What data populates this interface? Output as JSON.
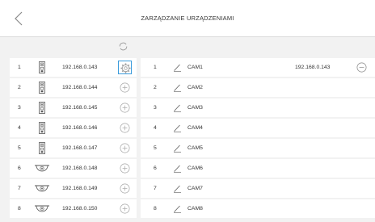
{
  "header": {
    "title": "ZARZĄDZANIE URZĄDZENIAMI"
  },
  "icons": {
    "back": "chevron-left-icon",
    "refresh": "refresh-icon",
    "settings": "gear-icon",
    "add": "plus-circle-icon",
    "edit": "pencil-icon",
    "remove": "minus-circle-icon"
  },
  "colors": {
    "background": "#f2f2f2",
    "row": "#ffffff",
    "selected_outline": "#3a9bdc",
    "icon": "#9a9a9a"
  },
  "devices": [
    {
      "num": "1",
      "type": "door-station-icon",
      "ip": "192.168.0.143",
      "action": "settings",
      "selected": true
    },
    {
      "num": "2",
      "type": "door-station-icon",
      "ip": "192.168.0.144",
      "action": "add",
      "selected": false
    },
    {
      "num": "3",
      "type": "door-station-icon",
      "ip": "192.168.0.145",
      "action": "add",
      "selected": false
    },
    {
      "num": "4",
      "type": "door-station-icon",
      "ip": "192.168.0.146",
      "action": "add",
      "selected": false
    },
    {
      "num": "5",
      "type": "door-station-icon",
      "ip": "192.168.0.147",
      "action": "add",
      "selected": false
    },
    {
      "num": "6",
      "type": "dome-camera-icon",
      "ip": "192.168.0.148",
      "action": "add",
      "selected": false
    },
    {
      "num": "7",
      "type": "dome-camera-icon",
      "ip": "192.168.0.149",
      "action": "add",
      "selected": false
    },
    {
      "num": "8",
      "type": "dome-camera-icon",
      "ip": "192.168.0.150",
      "action": "add",
      "selected": false
    }
  ],
  "cameras": [
    {
      "num": "1",
      "name": "CAM1",
      "ip": "192.168.0.143",
      "assigned": true
    },
    {
      "num": "2",
      "name": "CAM2",
      "ip": "",
      "assigned": false
    },
    {
      "num": "3",
      "name": "CAM3",
      "ip": "",
      "assigned": false
    },
    {
      "num": "4",
      "name": "CAM4",
      "ip": "",
      "assigned": false
    },
    {
      "num": "5",
      "name": "CAM5",
      "ip": "",
      "assigned": false
    },
    {
      "num": "6",
      "name": "CAM6",
      "ip": "",
      "assigned": false
    },
    {
      "num": "7",
      "name": "CAM7",
      "ip": "",
      "assigned": false
    },
    {
      "num": "8",
      "name": "CAM8",
      "ip": "",
      "assigned": false
    }
  ]
}
